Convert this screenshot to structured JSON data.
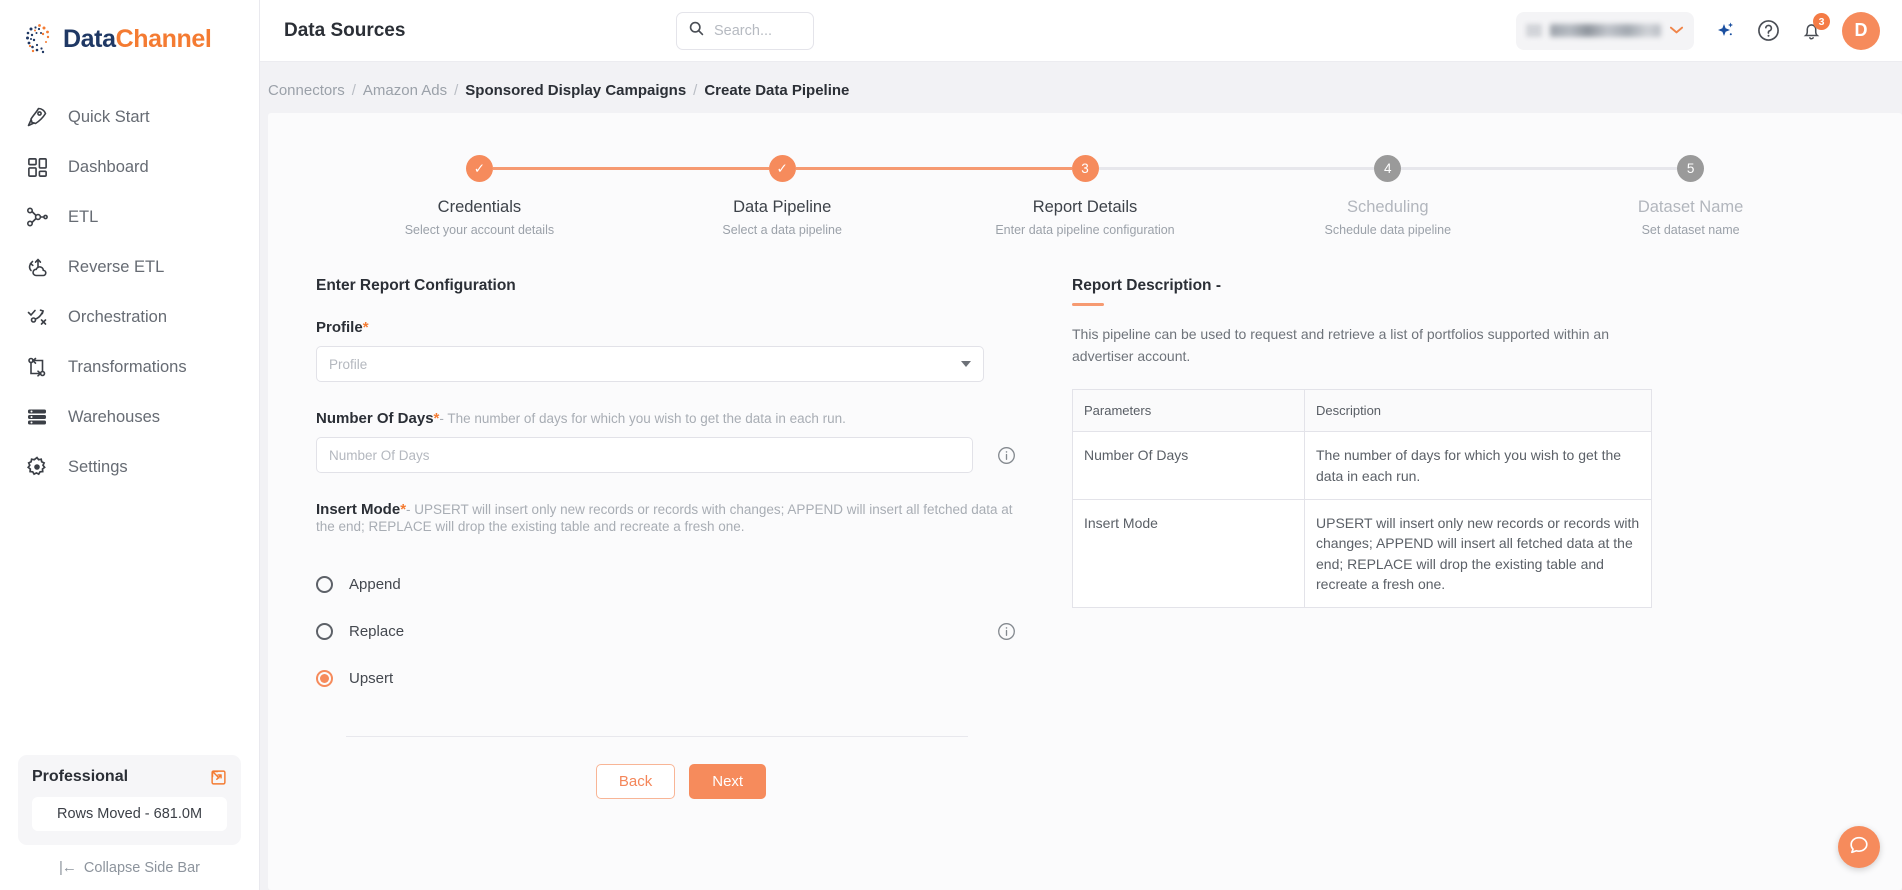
{
  "brand": {
    "name_part1": "Data",
    "name_part2": "Channel",
    "accent": "#f68b5c",
    "navy": "#1f3864"
  },
  "sidebar": {
    "items": [
      {
        "label": "Quick Start",
        "icon": "rocket-icon"
      },
      {
        "label": "Dashboard",
        "icon": "dashboard-grid-icon"
      },
      {
        "label": "ETL",
        "icon": "etl-nodes-icon"
      },
      {
        "label": "Reverse ETL",
        "icon": "reverse-etl-cloud-icon"
      },
      {
        "label": "Orchestration",
        "icon": "orchestration-icon"
      },
      {
        "label": "Transformations",
        "icon": "transformations-icon"
      },
      {
        "label": "Warehouses",
        "icon": "warehouse-stack-icon"
      },
      {
        "label": "Settings",
        "icon": "gear-icon"
      }
    ],
    "plan_name": "Professional",
    "rows_moved": "Rows Moved - 681.0M",
    "collapse_label": "Collapse Side Bar",
    "collapse_glyph": "|←"
  },
  "header": {
    "title": "Data Sources",
    "search_placeholder": "Search...",
    "notification_count": "3",
    "avatar_initial": "D",
    "icons": [
      "ai-sparkle-icon",
      "help-circle-icon",
      "bell-icon"
    ]
  },
  "breadcrumb": {
    "items": [
      {
        "label": "Connectors",
        "active": false
      },
      {
        "label": "Amazon Ads",
        "active": false
      },
      {
        "label": "Sponsored Display Campaigns",
        "active": true
      },
      {
        "label": "Create Data Pipeline",
        "active": true
      }
    ],
    "separator": "/"
  },
  "stepper": {
    "steps": [
      {
        "num": "1",
        "state": "done",
        "mark": "✓",
        "label": "Credentials",
        "sub": "Select your account details"
      },
      {
        "num": "2",
        "state": "done",
        "mark": "✓",
        "label": "Data Pipeline",
        "sub": "Select a data pipeline"
      },
      {
        "num": "3",
        "state": "active",
        "mark": "3",
        "label": "Report Details",
        "sub": "Enter data pipeline configuration"
      },
      {
        "num": "4",
        "state": "idle",
        "mark": "4",
        "label": "Scheduling",
        "sub": "Schedule data pipeline"
      },
      {
        "num": "5",
        "state": "idle",
        "mark": "5",
        "label": "Dataset Name",
        "sub": "Set dataset name"
      }
    ]
  },
  "form": {
    "section_title": "Enter Report Configuration",
    "profile": {
      "label": "Profile",
      "required": "*",
      "placeholder": "Profile",
      "value": ""
    },
    "number_of_days": {
      "label": "Number Of Days",
      "required": "*",
      "hint": "- The number of days for which you wish to get the data in each run.",
      "placeholder": "Number Of Days",
      "value": ""
    },
    "insert_mode": {
      "label": "Insert Mode",
      "required": "*",
      "hint": "- UPSERT will insert only new records or records with changes; APPEND will insert all fetched data at the end; REPLACE will drop the existing table and recreate a fresh one.",
      "options": [
        {
          "label": "Append",
          "selected": false
        },
        {
          "label": "Replace",
          "selected": false
        },
        {
          "label": "Upsert",
          "selected": true
        }
      ]
    },
    "back_label": "Back",
    "next_label": "Next"
  },
  "report_description": {
    "title": "Report Description -",
    "body": "This pipeline can be used to request and retrieve a list of portfolios supported within an advertiser account.",
    "table": {
      "headers": [
        "Parameters",
        "Description"
      ],
      "rows": [
        {
          "parameter": "Number Of Days",
          "description": "The number of days for which you wish to get the data in each run."
        },
        {
          "parameter": "Insert Mode",
          "description": "UPSERT will insert only new records or records with changes; APPEND will insert all fetched data at the end; REPLACE will drop the existing table and recreate a fresh one."
        }
      ]
    }
  },
  "chat": {
    "icon": "chat-bubble-icon"
  }
}
